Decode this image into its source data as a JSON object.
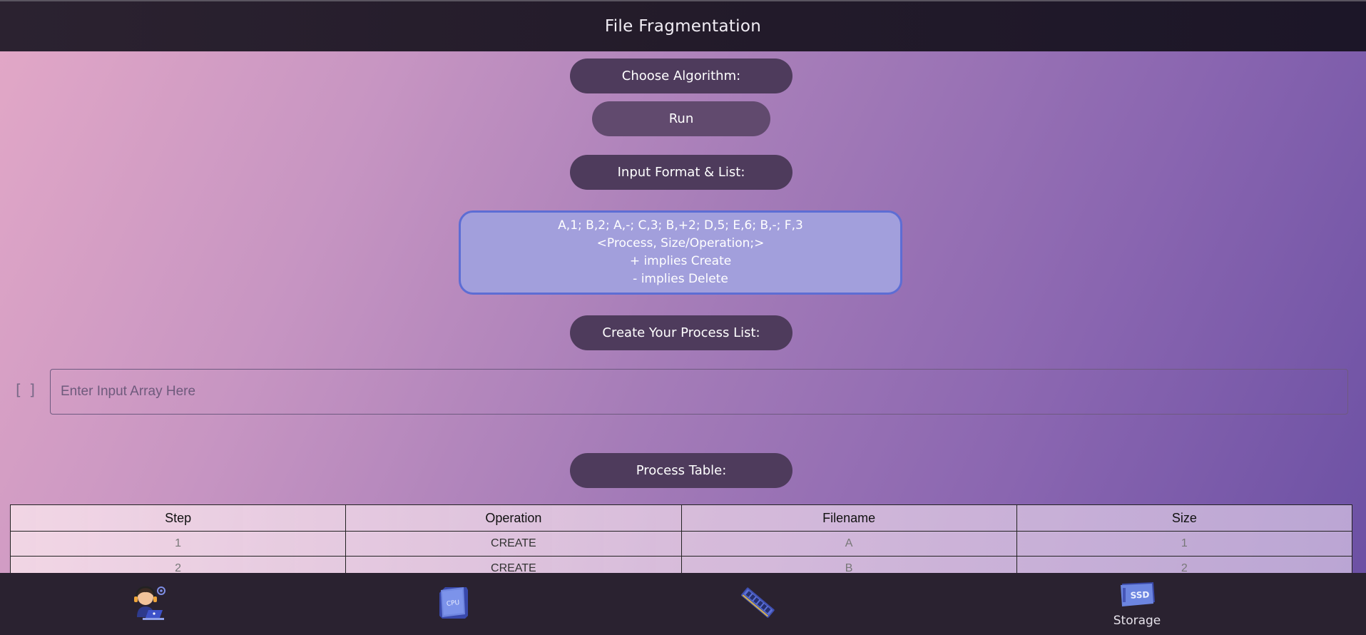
{
  "header": {
    "title": "File Fragmentation"
  },
  "controls": {
    "choose_algorithm_label": "Choose Algorithm:",
    "run_label": "Run",
    "input_format_label": "Input Format & List:",
    "create_list_label": "Create Your Process List:",
    "process_table_label": "Process Table:"
  },
  "format_info": {
    "line1": "A,1; B,2; A,-; C,3; B,+2; D,5; E,6; B,-; F,3",
    "line2": "<Process, Size/Operation;>",
    "line3": "+ implies Create",
    "line4": "- implies Delete"
  },
  "input": {
    "bracket_text": "[ ]",
    "placeholder": "Enter Input Array Here",
    "value": ""
  },
  "table": {
    "columns": [
      "Step",
      "Operation",
      "Filename",
      "Size"
    ],
    "rows": [
      {
        "step": "1",
        "operation": "CREATE",
        "filename": "A",
        "size": "1"
      },
      {
        "step": "2",
        "operation": "CREATE",
        "filename": "B",
        "size": "2"
      }
    ]
  },
  "bottom_nav": {
    "items": [
      {
        "icon": "support-agent-icon",
        "label": ""
      },
      {
        "icon": "cpu-icon",
        "label": ""
      },
      {
        "icon": "memory-ram-icon",
        "label": ""
      },
      {
        "icon": "ssd-icon",
        "label": "Storage"
      }
    ]
  },
  "colors": {
    "pill_bg": "#4e3b5c",
    "info_box_bg": "#a29fdc",
    "info_box_border": "#5d6dd4",
    "bar_bg": "#2a2230"
  }
}
